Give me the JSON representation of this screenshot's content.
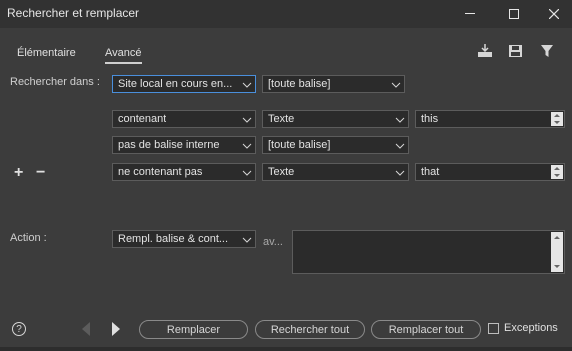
{
  "window": {
    "title": "Rechercher et remplacer"
  },
  "tabs": [
    {
      "label": "Élémentaire"
    },
    {
      "label": "Avancé"
    }
  ],
  "labels": {
    "search_in": "Rechercher dans :",
    "action": "Action :",
    "with_short": "av..."
  },
  "search_in": {
    "scope": "Site local en cours en...",
    "tag": "[toute balise]"
  },
  "rows": [
    {
      "condition": "contenant",
      "type": "Texte",
      "value": "this"
    },
    {
      "condition": "pas de balise interne",
      "tag": "[toute balise]"
    },
    {
      "condition": "ne contenant pas",
      "type": "Texte",
      "value": "that"
    }
  ],
  "add_symbol": "+",
  "remove_symbol": "−",
  "action": {
    "value": "Rempl. balise & cont...",
    "text": ""
  },
  "buttons": {
    "replace": "Remplacer",
    "find_all": "Rechercher tout",
    "replace_all": "Remplacer tout"
  },
  "exceptions_label": "Exceptions",
  "help_symbol": "?",
  "colors": {
    "background": "#3c3c3c",
    "field": "#2b2b2b",
    "focus": "#4a8fdc"
  }
}
